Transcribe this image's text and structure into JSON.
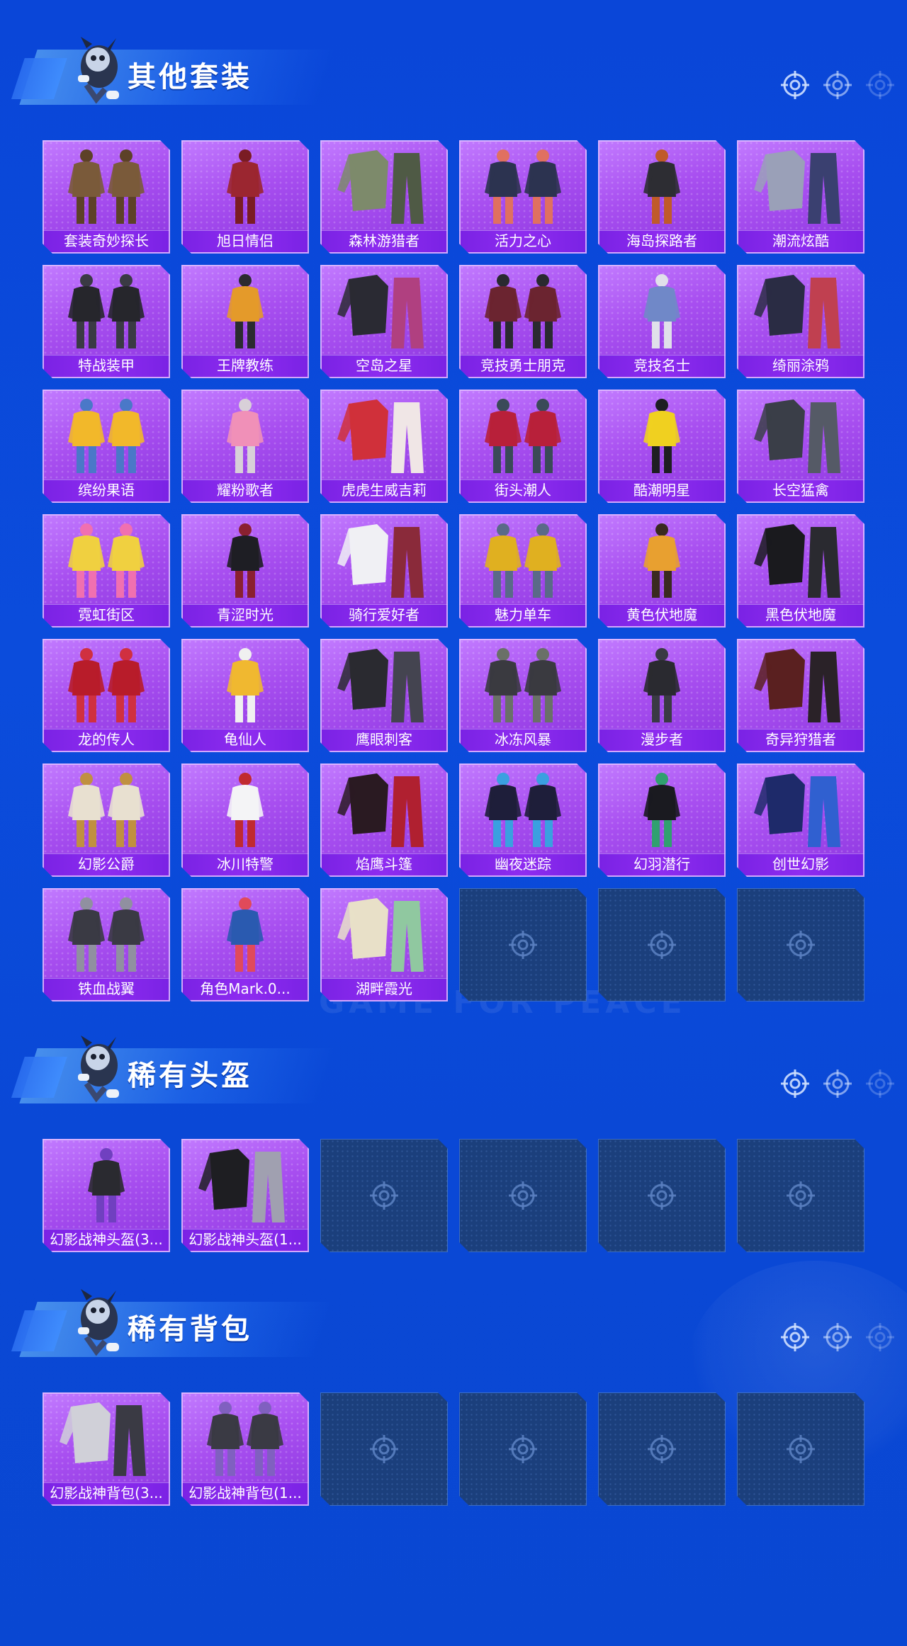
{
  "watermark": "GAME FOR PEACE",
  "sections": [
    {
      "title": "其他套装",
      "items": [
        {
          "name": "套装奇妙探长",
          "colors": [
            "#7a5a3a",
            "#5d4128"
          ]
        },
        {
          "name": "旭日情侣",
          "colors": [
            "#9b2630",
            "#7a1c24"
          ]
        },
        {
          "name": "森林游猎者",
          "colors": [
            "#7d8a6b",
            "#4f5a45"
          ]
        },
        {
          "name": "活力之心",
          "colors": [
            "#2c3350",
            "#e07060"
          ]
        },
        {
          "name": "海岛探路者",
          "colors": [
            "#2d2d33",
            "#c05a2a"
          ]
        },
        {
          "name": "潮流炫酷",
          "colors": [
            "#9aa0b8",
            "#3a4070"
          ]
        },
        {
          "name": "特战装甲",
          "colors": [
            "#26262c",
            "#3a3a44"
          ]
        },
        {
          "name": "王牌教练",
          "colors": [
            "#e49a2a",
            "#2b2b30"
          ]
        },
        {
          "name": "空岛之星",
          "colors": [
            "#2a2a33",
            "#b04080"
          ]
        },
        {
          "name": "竞技勇士朋克",
          "colors": [
            "#6b2430",
            "#2a2a30"
          ]
        },
        {
          "name": "竞技名士",
          "colors": [
            "#7088c8",
            "#e0e0ea"
          ]
        },
        {
          "name": "绮丽涂鸦",
          "colors": [
            "#2a2c44",
            "#c04050"
          ]
        },
        {
          "name": "缤纷果语",
          "colors": [
            "#f2b82a",
            "#4a78c8"
          ]
        },
        {
          "name": "耀粉歌者",
          "colors": [
            "#f090b8",
            "#d8d0d8"
          ]
        },
        {
          "name": "虎虎生威吉莉",
          "colors": [
            "#d0303a",
            "#f0e6e6"
          ]
        },
        {
          "name": "街头潮人",
          "colors": [
            "#b8203a",
            "#3a4a58"
          ]
        },
        {
          "name": "酷潮明星",
          "colors": [
            "#f0d020",
            "#1e1e22"
          ]
        },
        {
          "name": "长空猛禽",
          "colors": [
            "#3a3e48",
            "#555a66"
          ]
        },
        {
          "name": "霓虹街区",
          "colors": [
            "#f0d040",
            "#f070b0"
          ]
        },
        {
          "name": "青涩时光",
          "colors": [
            "#1e1e24",
            "#8a2030"
          ]
        },
        {
          "name": "骑行爱好者",
          "colors": [
            "#f0f0f4",
            "#8a2a3a"
          ]
        },
        {
          "name": "魅力单车",
          "colors": [
            "#e0b020",
            "#5a6a88"
          ]
        },
        {
          "name": "黄色伏地魔",
          "colors": [
            "#e8a030",
            "#3a2a20"
          ]
        },
        {
          "name": "黑色伏地魔",
          "colors": [
            "#1a1a1e",
            "#2a2a30"
          ]
        },
        {
          "name": "龙的传人",
          "colors": [
            "#b81c2a",
            "#d03040"
          ]
        },
        {
          "name": "龟仙人",
          "colors": [
            "#f0b830",
            "#f0f0f0"
          ]
        },
        {
          "name": "鹰眼刺客",
          "colors": [
            "#2a2a30",
            "#444450"
          ]
        },
        {
          "name": "冰冻风暴",
          "colors": [
            "#3a3a40",
            "#6a7068"
          ]
        },
        {
          "name": "漫步者",
          "colors": [
            "#2a2a30",
            "#3a3a44"
          ]
        },
        {
          "name": "奇异狩猎者",
          "colors": [
            "#5a2020",
            "#2a2228"
          ]
        },
        {
          "name": "幻影公爵",
          "colors": [
            "#e8e0d0",
            "#c09040"
          ]
        },
        {
          "name": "冰川特警",
          "colors": [
            "#f4f4f6",
            "#c02a30"
          ]
        },
        {
          "name": "焰鹰斗篷",
          "colors": [
            "#2a1a22",
            "#b02030"
          ]
        },
        {
          "name": "幽夜迷踪",
          "colors": [
            "#1e1e3a",
            "#3aa0e0"
          ]
        },
        {
          "name": "幻羽潜行",
          "colors": [
            "#1a1a20",
            "#30a070"
          ]
        },
        {
          "name": "创世幻影",
          "colors": [
            "#1e2a6a",
            "#3060d0"
          ]
        },
        {
          "name": "铁血战翼",
          "colors": [
            "#3a3a44",
            "#9090a0"
          ]
        },
        {
          "name": "角色Mark.0...",
          "colors": [
            "#2a5ab0",
            "#e04a5a"
          ]
        },
        {
          "name": "湖畔霞光",
          "colors": [
            "#e8e0c8",
            "#90c8a0"
          ]
        }
      ],
      "empty_slots": 3
    },
    {
      "title": "稀有头盔",
      "items": [
        {
          "name": "幻影战神头盔(3...",
          "colors": [
            "#2a2a30",
            "#7040c0"
          ]
        },
        {
          "name": "幻影战神头盔(1...",
          "colors": [
            "#1e1e22",
            "#a0a0b0"
          ]
        }
      ],
      "empty_slots": 4
    },
    {
      "title": "稀有背包",
      "items": [
        {
          "name": "幻影战神背包(3...",
          "colors": [
            "#d0d0d8",
            "#3a3a44"
          ]
        },
        {
          "name": "幻影战神背包(1...",
          "colors": [
            "#3a3a44",
            "#8060c0"
          ]
        }
      ],
      "empty_slots": 4
    }
  ],
  "icons": {
    "crosshair": "crosshair-icon",
    "mascot": "mascot-icon"
  }
}
